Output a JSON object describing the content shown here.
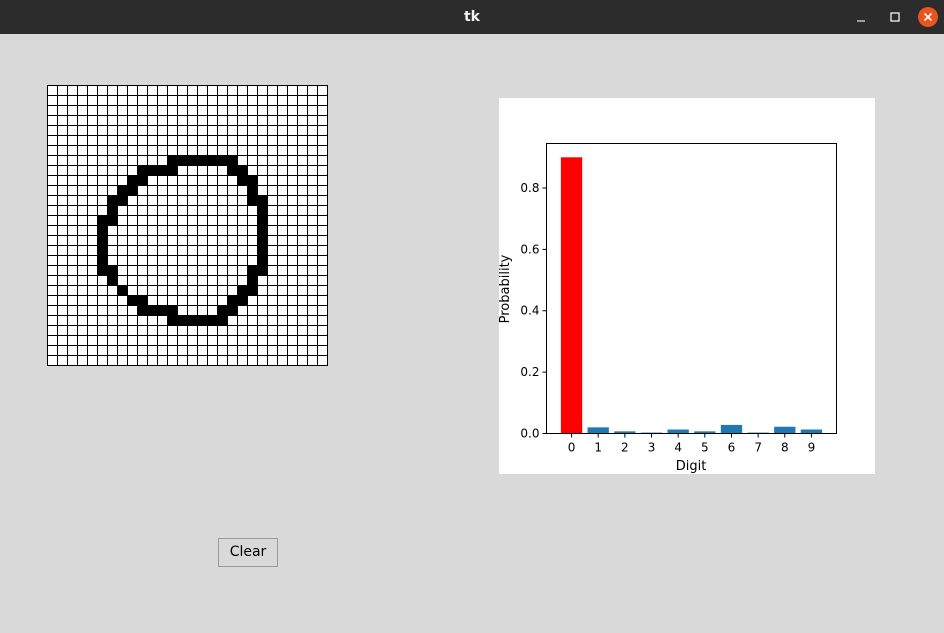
{
  "window": {
    "title": "tk",
    "controls": {
      "minimize_icon": "minimize-icon",
      "maximize_icon": "maximize-icon",
      "close_icon": "close-icon"
    }
  },
  "drawing_grid": {
    "rows": 28,
    "cols": 28,
    "cell_fill_color": "#000000",
    "background_color": "#ffffff",
    "filled_cells": [
      [
        7,
        12
      ],
      [
        7,
        13
      ],
      [
        7,
        14
      ],
      [
        7,
        15
      ],
      [
        7,
        16
      ],
      [
        7,
        17
      ],
      [
        7,
        18
      ],
      [
        8,
        9
      ],
      [
        8,
        10
      ],
      [
        8,
        11
      ],
      [
        8,
        12
      ],
      [
        8,
        18
      ],
      [
        8,
        19
      ],
      [
        9,
        8
      ],
      [
        9,
        9
      ],
      [
        9,
        19
      ],
      [
        9,
        20
      ],
      [
        10,
        7
      ],
      [
        10,
        8
      ],
      [
        10,
        20
      ],
      [
        11,
        6
      ],
      [
        11,
        7
      ],
      [
        11,
        20
      ],
      [
        11,
        21
      ],
      [
        12,
        6
      ],
      [
        12,
        21
      ],
      [
        13,
        5
      ],
      [
        13,
        6
      ],
      [
        13,
        21
      ],
      [
        14,
        5
      ],
      [
        14,
        21
      ],
      [
        15,
        5
      ],
      [
        15,
        21
      ],
      [
        16,
        5
      ],
      [
        16,
        21
      ],
      [
        17,
        5
      ],
      [
        17,
        21
      ],
      [
        18,
        5
      ],
      [
        18,
        6
      ],
      [
        18,
        20
      ],
      [
        18,
        21
      ],
      [
        19,
        6
      ],
      [
        19,
        20
      ],
      [
        20,
        7
      ],
      [
        20,
        19
      ],
      [
        20,
        20
      ],
      [
        21,
        8
      ],
      [
        21,
        9
      ],
      [
        21,
        18
      ],
      [
        21,
        19
      ],
      [
        22,
        9
      ],
      [
        22,
        10
      ],
      [
        22,
        11
      ],
      [
        22,
        12
      ],
      [
        22,
        17
      ],
      [
        22,
        18
      ],
      [
        23,
        12
      ],
      [
        23,
        13
      ],
      [
        23,
        14
      ],
      [
        23,
        15
      ],
      [
        23,
        16
      ],
      [
        23,
        17
      ]
    ]
  },
  "chart_data": {
    "type": "bar",
    "categories": [
      "0",
      "1",
      "2",
      "3",
      "4",
      "5",
      "6",
      "7",
      "8",
      "9"
    ],
    "values": [
      0.9,
      0.02,
      0.007,
      0.003,
      0.013,
      0.007,
      0.028,
      0.003,
      0.022,
      0.013
    ],
    "highlight_index": 0,
    "highlight_color": "#ff0000",
    "bar_color": "#1f77b4",
    "xlabel": "Digit",
    "ylabel": "Probability",
    "ylim": [
      0,
      0.945
    ],
    "yticks": [
      0.0,
      0.2,
      0.4,
      0.6,
      0.8
    ],
    "ytick_labels": [
      "0.0",
      "0.2",
      "0.4",
      "0.6",
      "0.8"
    ],
    "grid": false,
    "title": ""
  },
  "controls": {
    "clear_label": "Clear"
  }
}
